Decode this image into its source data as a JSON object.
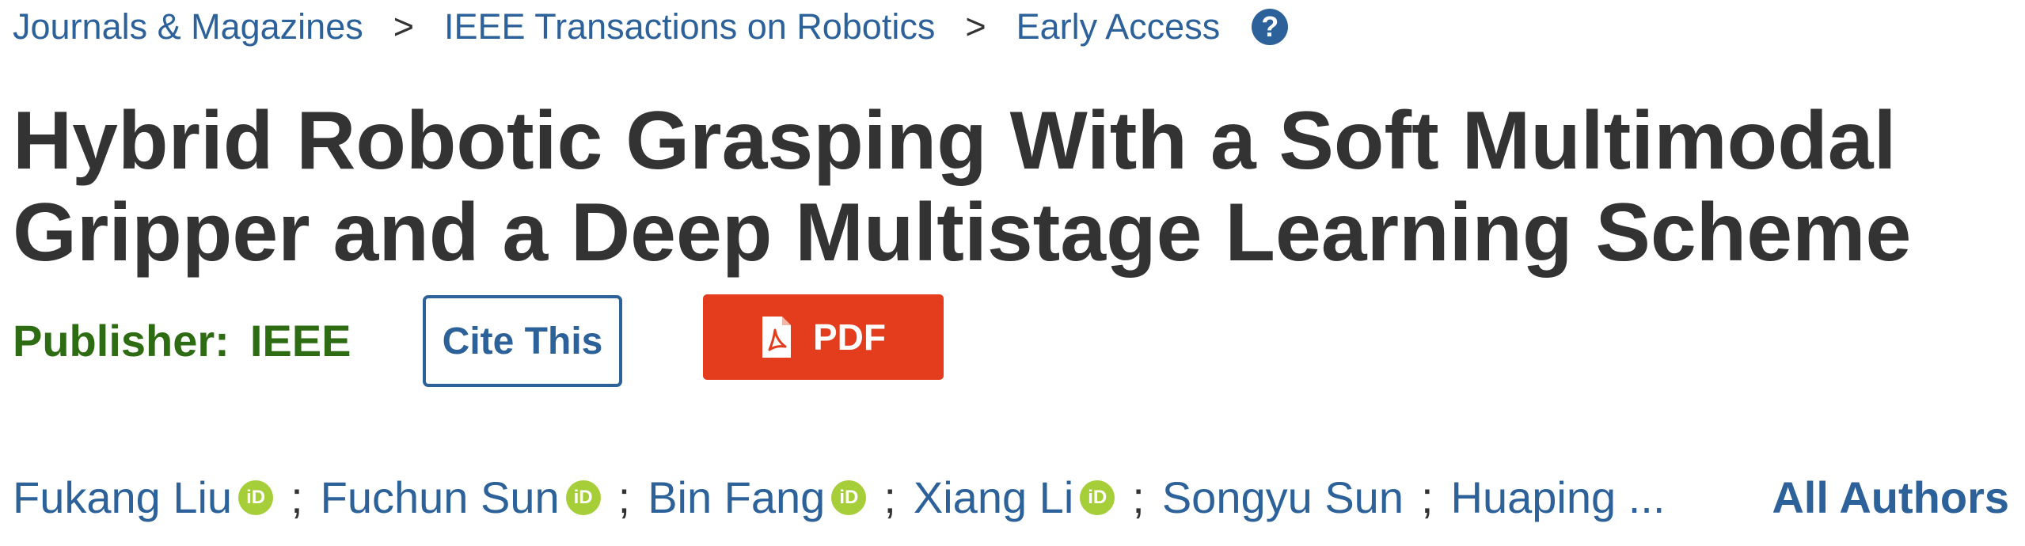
{
  "breadcrumb": {
    "items": [
      "Journals & Magazines",
      "IEEE Transactions on Robotics",
      "Early Access"
    ],
    "separator": ">",
    "help_icon": "question-circle-icon"
  },
  "article": {
    "title_line1": "Hybrid Robotic Grasping With a Soft Multimodal",
    "title_line2": "Gripper and a Deep Multistage Learning Scheme",
    "publisher_label": "Publisher:",
    "publisher_value": "IEEE"
  },
  "actions": {
    "cite_label": "Cite This",
    "pdf_label": "PDF",
    "pdf_icon": "pdf-file-icon"
  },
  "authors": {
    "list": [
      {
        "name": "Fukang Liu",
        "orcid": true
      },
      {
        "name": "Fuchun Sun",
        "orcid": true
      },
      {
        "name": "Bin Fang",
        "orcid": true
      },
      {
        "name": "Xiang Li",
        "orcid": true
      },
      {
        "name": "Songyu Sun",
        "orcid": false
      },
      {
        "name": "Huaping ...",
        "orcid": false
      }
    ],
    "separator": ";",
    "orcid_badge": "iD",
    "all_authors_label": "All Authors"
  },
  "colors": {
    "link": "#2c6199",
    "title": "#333333",
    "publisher": "#2e6c14",
    "pdf_button": "#e33d1e",
    "orcid": "#a6ce39"
  }
}
